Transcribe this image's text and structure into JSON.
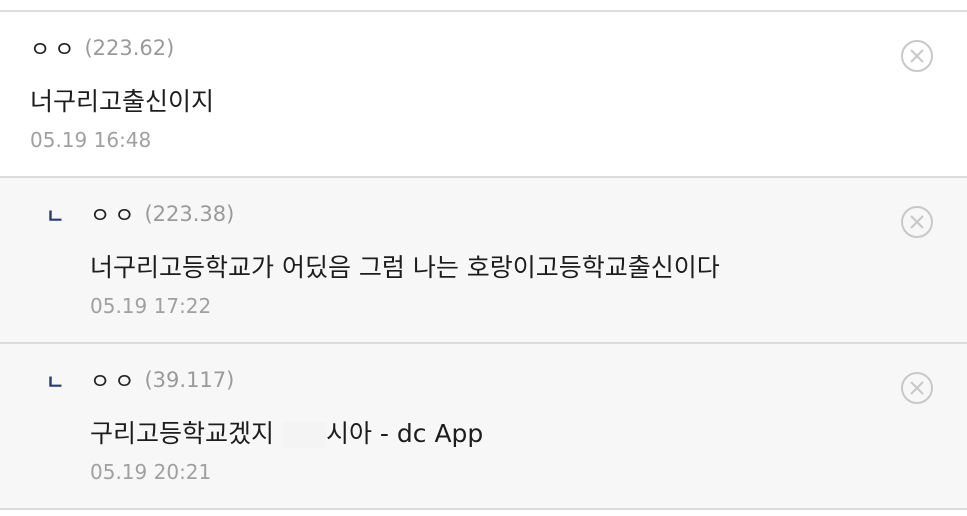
{
  "comments": [
    {
      "reply": false,
      "author": "ㅇㅇ",
      "ip": "(223.62)",
      "text": "너구리고출신이지",
      "date": "05.19 16:48"
    },
    {
      "reply": true,
      "reply_mark": "ㄴ",
      "author": "ㅇㅇ",
      "ip": "(223.38)",
      "text": "너구리고등학교가 어딨음 그럼 나는 호랑이고등학교출신이다",
      "date": "05.19 17:22"
    },
    {
      "reply": true,
      "reply_mark": "ㄴ",
      "author": "ㅇㅇ",
      "ip": "(39.117)",
      "text_before": "구리고등학교겠지",
      "text_after": "시아 - dc App",
      "date": "05.19 20:21"
    }
  ],
  "icons": {
    "delete": "close-circle-icon"
  },
  "colors": {
    "reply_mark": "#2b3a78",
    "meta": "#9a9a9a",
    "reply_bg": "#f7f7f8"
  }
}
